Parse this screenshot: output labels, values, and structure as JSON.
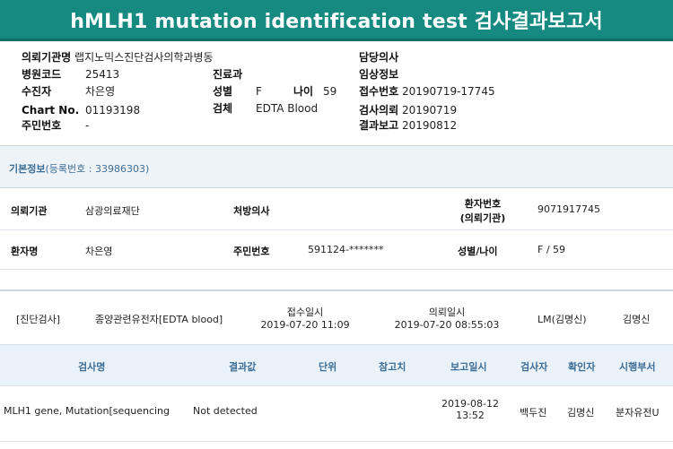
{
  "title": "hMLH1 mutation identification test 검사결과보고서",
  "header": {
    "left": [
      {
        "label": "의뢰기관명",
        "value": "랩지노믹스진단검사의학과병동"
      },
      {
        "label": "병원코드",
        "value": "25413"
      },
      {
        "label": "수진자",
        "value": "차은영"
      },
      {
        "label": "Chart No.",
        "value": "01193198"
      },
      {
        "label": "주민번호",
        "value": "-"
      }
    ],
    "middle": [
      {
        "label": "진료과",
        "value": ""
      },
      {
        "label": "성별",
        "value": "F"
      },
      {
        "label": "검체",
        "value": "EDTA Blood"
      }
    ],
    "age": {
      "label": "나이",
      "value": "59"
    },
    "right": [
      {
        "label": "담당의사",
        "value": ""
      },
      {
        "label": "임상정보",
        "value": ""
      },
      {
        "label": "접수번호",
        "value": "20190719-17745"
      },
      {
        "label": "검사의뢰",
        "value": "20190719"
      },
      {
        "label": "결과보고",
        "value": "20190812"
      }
    ]
  },
  "basic_info": {
    "title": "기본정보",
    "reg_label": "(등록번호 : 33986303)"
  },
  "patient": {
    "institution_label": "의뢰기관",
    "institution_value": "삼광의료재단",
    "doctor_label": "처방의사",
    "doctor_value": "",
    "patient_no_label_1": "환자번호",
    "patient_no_label_2": "(의뢰기관)",
    "patient_no_value": "9071917745",
    "name_label": "환자명",
    "name_value": "차은영",
    "rrn_label": "주민번호",
    "rrn_value": "591124-*******",
    "sexage_label": "성별/나이",
    "sexage_value": "F / 59"
  },
  "order": {
    "category": "[진단검사]",
    "test": "종양관련유전자[EDTA blood]",
    "received_label": "접수일시",
    "received_value": "2019-07-20 11:09",
    "requested_label": "의뢰일시",
    "requested_value": "2019-07-20 08:55:03",
    "lm": "LM(김명신)",
    "doctor": "김명신"
  },
  "results_table": {
    "headers": [
      "검사명",
      "결과값",
      "단위",
      "참고치",
      "보고일시",
      "검사자",
      "확인자",
      "시행부서"
    ],
    "rows": [
      {
        "test_name": "MLH1 gene, Mutation[sequencing",
        "result": "Not detected",
        "unit": "",
        "reference": "",
        "report_date": "2019-08-12",
        "report_time": "13:52",
        "tester": "백두진",
        "confirmer": "김명신",
        "department": "분자유전U"
      }
    ]
  }
}
